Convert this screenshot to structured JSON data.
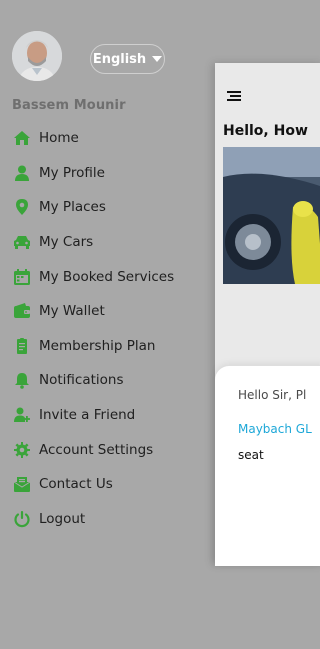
{
  "drawer": {
    "user_name": "Bassem Mounir",
    "language_label": "English",
    "accent_color": "#3aa43a",
    "menu": [
      {
        "label": "Home",
        "icon": "home-icon"
      },
      {
        "label": "My Profile",
        "icon": "user-icon"
      },
      {
        "label": "My Places",
        "icon": "location-pin-icon"
      },
      {
        "label": "My Cars",
        "icon": "car-icon"
      },
      {
        "label": "My Booked Services",
        "icon": "calendar-icon"
      },
      {
        "label": "My Wallet",
        "icon": "wallet-icon"
      },
      {
        "label": "Membership Plan",
        "icon": "membership-icon"
      },
      {
        "label": "Notifications",
        "icon": "bell-icon"
      },
      {
        "label": "Invite a Friend",
        "icon": "invite-friend-icon"
      },
      {
        "label": "Account Settings",
        "icon": "gear-icon"
      },
      {
        "label": "Contact Us",
        "icon": "contact-icon"
      },
      {
        "label": "Logout",
        "icon": "power-icon"
      }
    ]
  },
  "main": {
    "greeting": "Hello, How",
    "card_text": "Hello Sir, Pl",
    "card_link": "Maybach GL",
    "card_seat": "seat"
  }
}
